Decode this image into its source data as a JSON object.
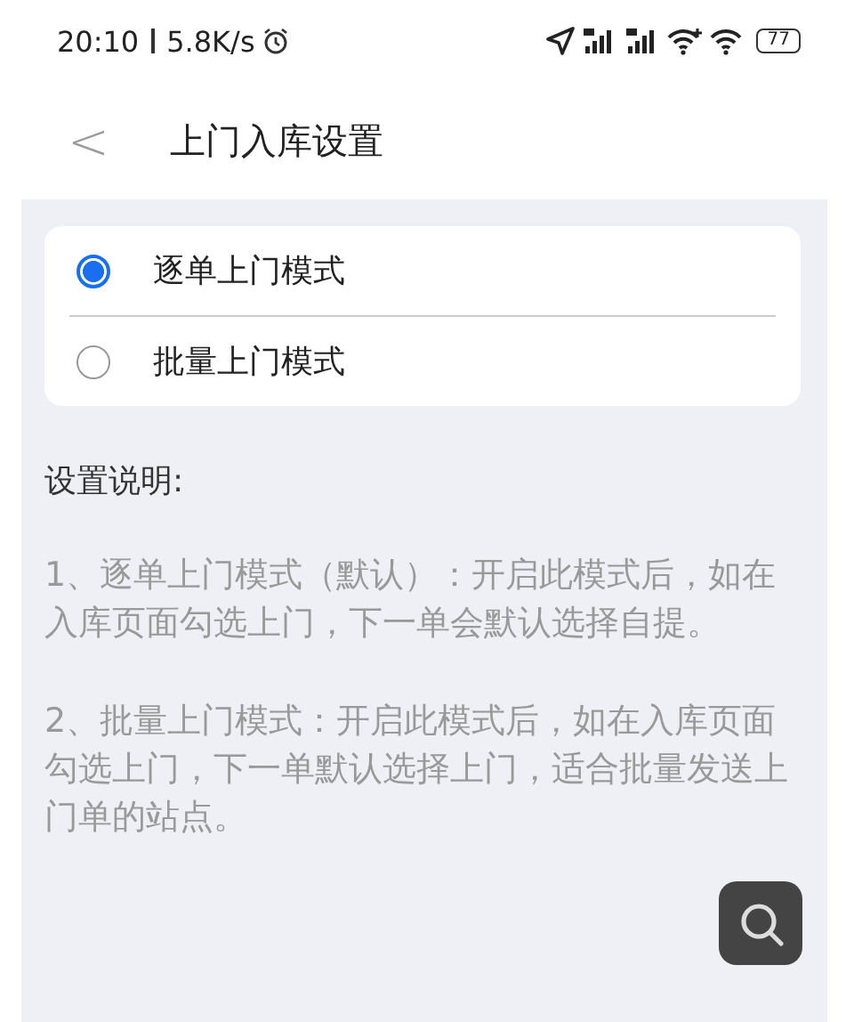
{
  "status_bar": {
    "time": "20:10",
    "speed": "5.8K/s",
    "battery": "77"
  },
  "header": {
    "back": "<",
    "title": "上门入库设置"
  },
  "options": [
    {
      "label": "逐单上门模式",
      "selected": true
    },
    {
      "label": "批量上门模式",
      "selected": false
    }
  ],
  "notes": {
    "heading": "设置说明:",
    "paragraphs": [
      "1、逐单上门模式（默认）：开启此模式后，如在入库页面勾选上门，下一单会默认选择自提。",
      "2、批量上门模式：开启此模式后，如在入库页面勾选上门，下一单默认选择上门，适合批量发送上门单的站点。"
    ]
  }
}
